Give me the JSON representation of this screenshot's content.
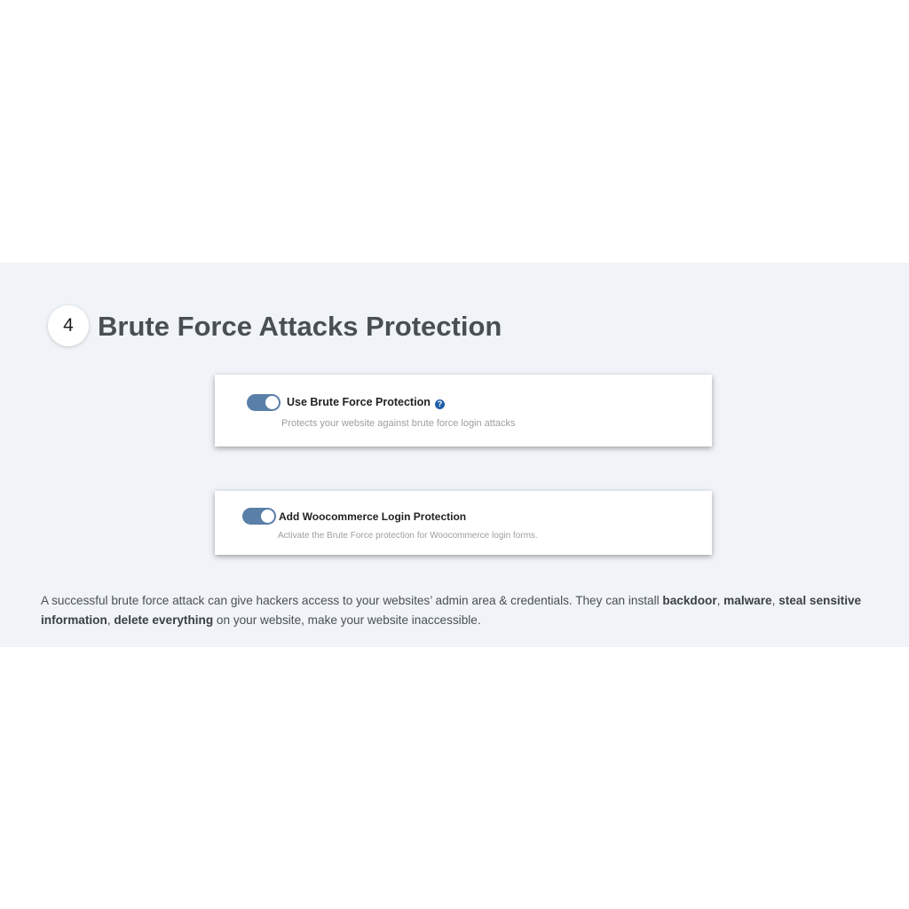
{
  "section": {
    "step_number": "4",
    "title": "Brute Force Attacks Protection"
  },
  "options": [
    {
      "label": "Use Brute Force Protection",
      "description": "Protects your website against brute force login attacks",
      "enabled": true,
      "help_icon": "question-circle-icon"
    },
    {
      "label": "Add Woocommerce Login Protection",
      "description": "Activate the Brute Force protection for Woocommerce login forms.",
      "enabled": true
    }
  ],
  "paragraph": {
    "intro": "A successful brute force attack can give hackers access to your websites’ admin area & credentials. They can install ",
    "bold_1": "backdoor",
    "sep_1": ", ",
    "bold_2": "malware",
    "sep_2": ", ",
    "bold_3": "steal sensitive information",
    "sep_3": ", ",
    "bold_4": "delete everything",
    "outro": " on your website, make your website inaccessible."
  },
  "colors": {
    "band_background": "#f0f4f8",
    "toggle_on": "#5a7fa8",
    "help_icon": "#1f5fa8",
    "title_text": "#4a4f55"
  }
}
